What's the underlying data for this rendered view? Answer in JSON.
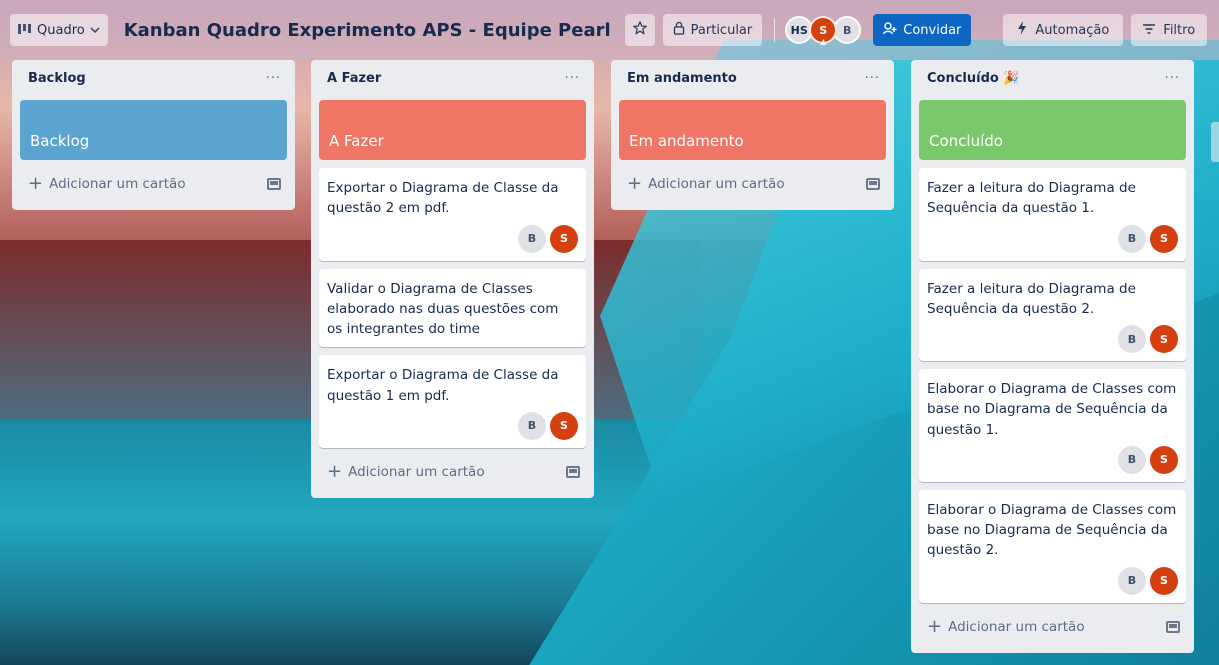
{
  "header": {
    "board_switcher_label": "Quadro",
    "board_title": "Kanban Quadro Experimento APS - Equipe Pearl",
    "visibility_label": "Particular",
    "members": [
      "HS",
      "S",
      "B"
    ],
    "invite_label": "Convidar",
    "automation_label": "Automação",
    "filter_label": "Filtro"
  },
  "lists": [
    {
      "title": "Backlog",
      "menu": "···",
      "cover_label": "Backlog",
      "cover_color": "#5ba4cf",
      "cards": [],
      "add_label": "Adicionar um cartão"
    },
    {
      "title": "A Fazer",
      "menu": "···",
      "cover_label": "A Fazer",
      "cover_color": "#ef7564",
      "cards": [
        {
          "text": "Exportar o Diagrama de Classe da questão 2 em pdf.",
          "members": [
            "B",
            "S"
          ]
        },
        {
          "text": "Validar o Diagrama de Classes elaborado nas duas questões com os integrantes do time",
          "members": []
        },
        {
          "text": "Exportar o Diagrama de Classe da questão 1 em pdf.",
          "members": [
            "B",
            "S"
          ]
        }
      ],
      "add_label": "Adicionar um cartão"
    },
    {
      "title": "Em andamento",
      "menu": "···",
      "cover_label": "Em andamento",
      "cover_color": "#ef7564",
      "cards": [],
      "add_label": "Adicionar um cartão"
    },
    {
      "title": "Concluído",
      "title_emoji": "🎉",
      "menu": "···",
      "cover_label": "Concluído",
      "cover_color": "#7bc86c",
      "cards": [
        {
          "text": "Fazer a leitura do Diagrama de Sequência da questão 1.",
          "members": [
            "B",
            "S"
          ]
        },
        {
          "text": "Fazer a leitura do Diagrama de Sequência da questão 2.",
          "members": [
            "B",
            "S"
          ]
        },
        {
          "text": "Elaborar o Diagrama de Classes com base no Diagrama de Sequência da questão 1.",
          "members": [
            "B",
            "S"
          ]
        },
        {
          "text": "Elaborar o Diagrama de Classes com base no Diagrama de Sequência da questão 2.",
          "members": [
            "B",
            "S"
          ]
        }
      ],
      "add_label": "Adicionar um cartão"
    }
  ],
  "icons": {
    "board": "board-icon",
    "chevron": "chevron-down-icon",
    "star": "star-icon",
    "lock": "lock-icon",
    "invite": "add-person-icon",
    "automation": "lightning-icon",
    "filter": "filter-icon",
    "template": "card-template-icon"
  }
}
